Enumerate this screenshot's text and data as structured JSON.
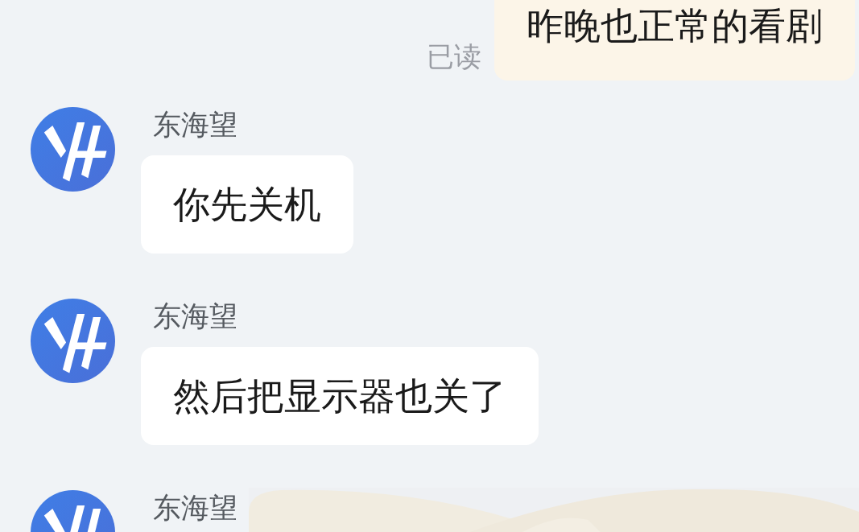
{
  "messages": [
    {
      "kind": "outgoing",
      "text": "昨晚也正常的看剧",
      "status": "已读"
    },
    {
      "kind": "incoming",
      "sender": "东海望",
      "text": "你先关机"
    },
    {
      "kind": "incoming",
      "sender": "东海望",
      "text": "然后把显示器也关了"
    },
    {
      "kind": "picture",
      "sender": "东海望"
    }
  ]
}
